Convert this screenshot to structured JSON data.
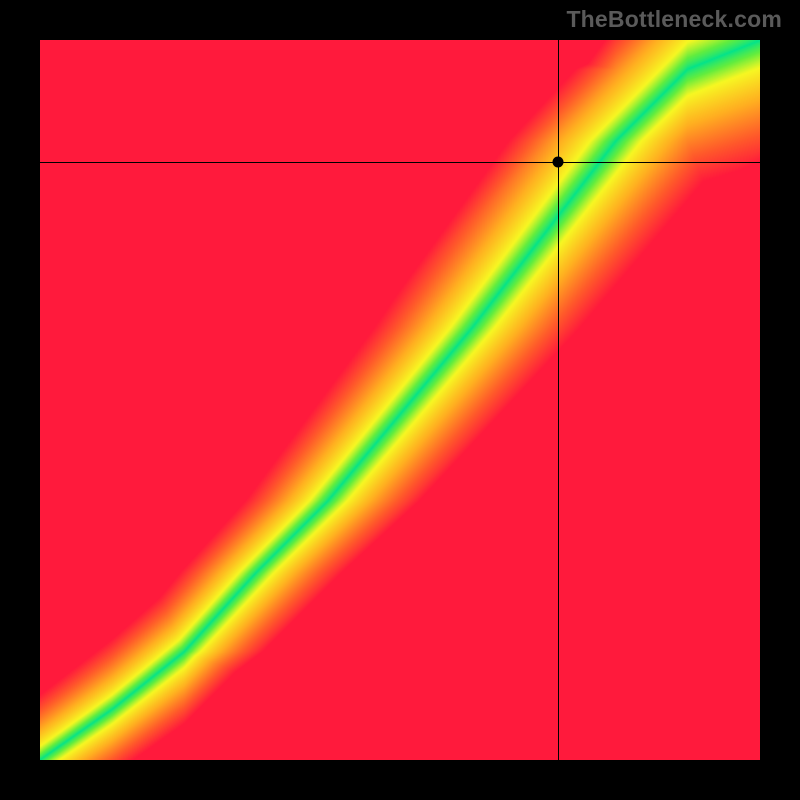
{
  "watermark": "TheBottleneck.com",
  "chart_data": {
    "type": "heatmap",
    "title": "",
    "xlabel": "",
    "ylabel": "",
    "xlim": [
      0,
      1
    ],
    "ylim": [
      0,
      1
    ],
    "grid": false,
    "legend": false,
    "crosshair_point": {
      "x": 0.72,
      "y": 0.83
    },
    "diagonal_band": {
      "description": "Green optimal band along a curved diagonal; colors fade through yellow/orange to red with distance from band center",
      "control_points": [
        {
          "x": 0.0,
          "y": 0.0
        },
        {
          "x": 0.1,
          "y": 0.07
        },
        {
          "x": 0.2,
          "y": 0.15
        },
        {
          "x": 0.3,
          "y": 0.26
        },
        {
          "x": 0.4,
          "y": 0.36
        },
        {
          "x": 0.5,
          "y": 0.48
        },
        {
          "x": 0.6,
          "y": 0.6
        },
        {
          "x": 0.7,
          "y": 0.73
        },
        {
          "x": 0.8,
          "y": 0.86
        },
        {
          "x": 0.9,
          "y": 0.96
        },
        {
          "x": 1.0,
          "y": 1.0
        }
      ],
      "band_half_width": 0.05
    },
    "colormap": {
      "stops": [
        {
          "t": 0.0,
          "color": "#00e38d"
        },
        {
          "t": 0.15,
          "color": "#62ed3e"
        },
        {
          "t": 0.3,
          "color": "#f7f722"
        },
        {
          "t": 0.55,
          "color": "#ffb020"
        },
        {
          "t": 0.8,
          "color": "#ff5a2a"
        },
        {
          "t": 1.0,
          "color": "#ff1a3c"
        }
      ]
    }
  }
}
